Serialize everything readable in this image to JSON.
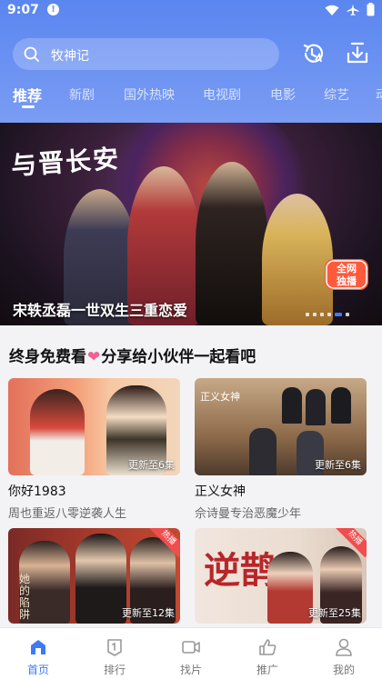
{
  "status_bar": {
    "time": "9:07",
    "alert_glyph": "!"
  },
  "search": {
    "placeholder": "牧神记",
    "icon": "search-icon"
  },
  "header_actions": [
    {
      "name": "history",
      "icon": "history-icon"
    },
    {
      "name": "download",
      "icon": "download-icon"
    }
  ],
  "tabs": [
    {
      "label": "推荐",
      "active": true
    },
    {
      "label": "新剧",
      "active": false
    },
    {
      "label": "国外热映",
      "active": false
    },
    {
      "label": "电视剧",
      "active": false
    },
    {
      "label": "电影",
      "active": false
    },
    {
      "label": "综艺",
      "active": false
    },
    {
      "label": "动",
      "active": false
    }
  ],
  "banner": {
    "logo_text": "与晋长安",
    "caption": "宋轶丞磊一世双生三重恋爱",
    "badge_line1": "全网",
    "badge_line2": "独播",
    "slide_count": 6,
    "active_slide": 4
  },
  "section": {
    "title_before": "终身免费看",
    "heart": "❤",
    "title_after": "分享给小伙伴一起看吧"
  },
  "cards": [
    {
      "title": "你好1983",
      "desc": "周也重返八零逆袭人生",
      "episode": "更新至6集",
      "hot": null
    },
    {
      "title": "正义女神",
      "desc": "佘诗曼专治恶魔少年",
      "episode": "更新至6集",
      "hot": null,
      "thumb_text": "正义女神"
    },
    {
      "title": "",
      "desc": "",
      "episode": "更新至12集",
      "hot": "热播",
      "thumb_text": "她的陷阱"
    },
    {
      "title": "",
      "desc": "",
      "episode": "更新至25集",
      "hot": "热播",
      "thumb_text": "逆鹊"
    }
  ],
  "bottom_nav": [
    {
      "label": "首页",
      "icon": "home-icon",
      "active": true
    },
    {
      "label": "排行",
      "icon": "ranking-icon",
      "active": false
    },
    {
      "label": "找片",
      "icon": "video-search-icon",
      "active": false
    },
    {
      "label": "推广",
      "icon": "promote-icon",
      "active": false
    },
    {
      "label": "我的",
      "icon": "profile-icon",
      "active": false
    }
  ],
  "colors": {
    "accent": "#3d7bf5",
    "header_top": "#5a86f0",
    "heart": "#f06292",
    "hot_tag": "#f04d4d"
  }
}
